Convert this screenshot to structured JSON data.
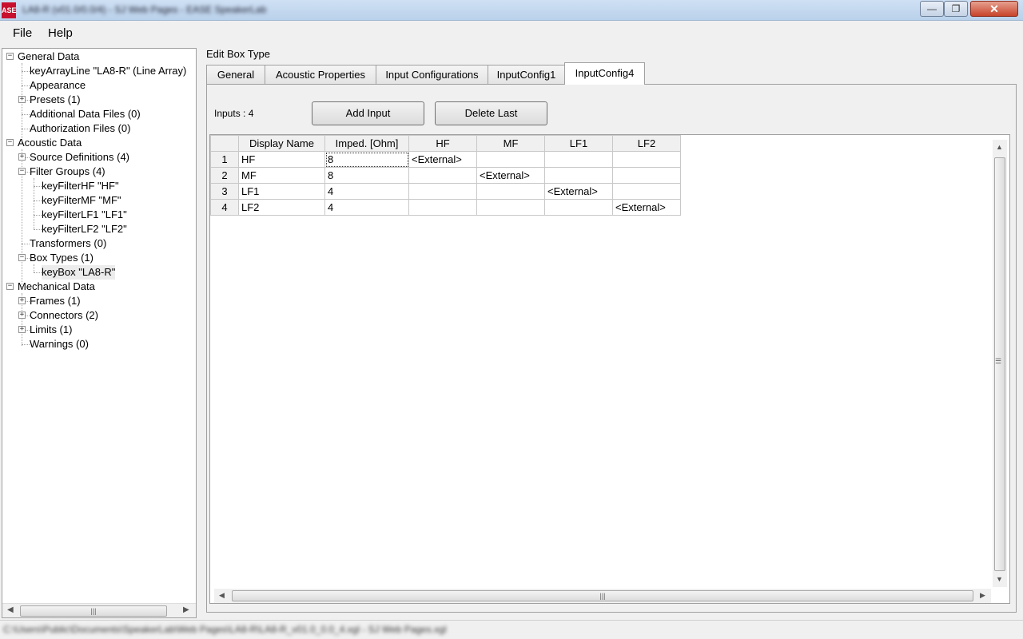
{
  "window": {
    "title": "LA8-R (v01.0/0.0/4) - SJ Web Pages - EASE SpeakerLab",
    "icon_label": "ASE",
    "minimize": "—",
    "maximize": "❐",
    "close": "✕"
  },
  "menu": {
    "file": "File",
    "help": "Help"
  },
  "tree": {
    "general_data": "General Data",
    "key_array_line": "keyArrayLine \"LA8-R\" (Line Array)",
    "appearance": "Appearance",
    "presets": "Presets  (1)",
    "additional_data_files": "Additional Data Files  (0)",
    "authorization_files": "Authorization Files  (0)",
    "acoustic_data": "Acoustic Data",
    "source_definitions": "Source Definitions  (4)",
    "filter_groups": "Filter Groups  (4)",
    "filter_hf": "keyFilterHF \"HF\"",
    "filter_mf": "keyFilterMF \"MF\"",
    "filter_lf1": "keyFilterLF1 \"LF1\"",
    "filter_lf2": "keyFilterLF2 \"LF2\"",
    "transformers": "Transformers  (0)",
    "box_types": "Box Types  (1)",
    "key_box": "keyBox \"LA8-R\"",
    "mechanical_data": "Mechanical Data",
    "frames": "Frames  (1)",
    "connectors": "Connectors  (2)",
    "limits": "Limits  (1)",
    "warnings": "Warnings  (0)"
  },
  "editor": {
    "title": "Edit Box Type",
    "tabs": [
      "General",
      "Acoustic Properties",
      "Input Configurations",
      "InputConfig1",
      "InputConfig4"
    ],
    "active_tab": "InputConfig4",
    "inputs_label": "Inputs : 4",
    "add_input": "Add Input",
    "delete_last": "Delete Last"
  },
  "grid": {
    "columns": [
      "Display Name",
      "Imped. [Ohm]",
      "HF",
      "MF",
      "LF1",
      "LF2"
    ],
    "rows": [
      {
        "num": "1",
        "name": "HF",
        "imped": "8",
        "hf": "<External>",
        "mf": "",
        "lf1": "",
        "lf2": ""
      },
      {
        "num": "2",
        "name": "MF",
        "imped": "8",
        "hf": "",
        "mf": "<External>",
        "lf1": "",
        "lf2": ""
      },
      {
        "num": "3",
        "name": "LF1",
        "imped": "4",
        "hf": "",
        "mf": "",
        "lf1": "<External>",
        "lf2": ""
      },
      {
        "num": "4",
        "name": "LF2",
        "imped": "4",
        "hf": "",
        "mf": "",
        "lf1": "",
        "lf2": "<External>"
      }
    ]
  },
  "statusbar": {
    "path": "C:\\Users\\Public\\Documents\\SpeakerLab\\Web Pages\\LA8-R\\LA8-R_v01.0_0.0_4.xgl - SJ Web Pages.xgl"
  }
}
